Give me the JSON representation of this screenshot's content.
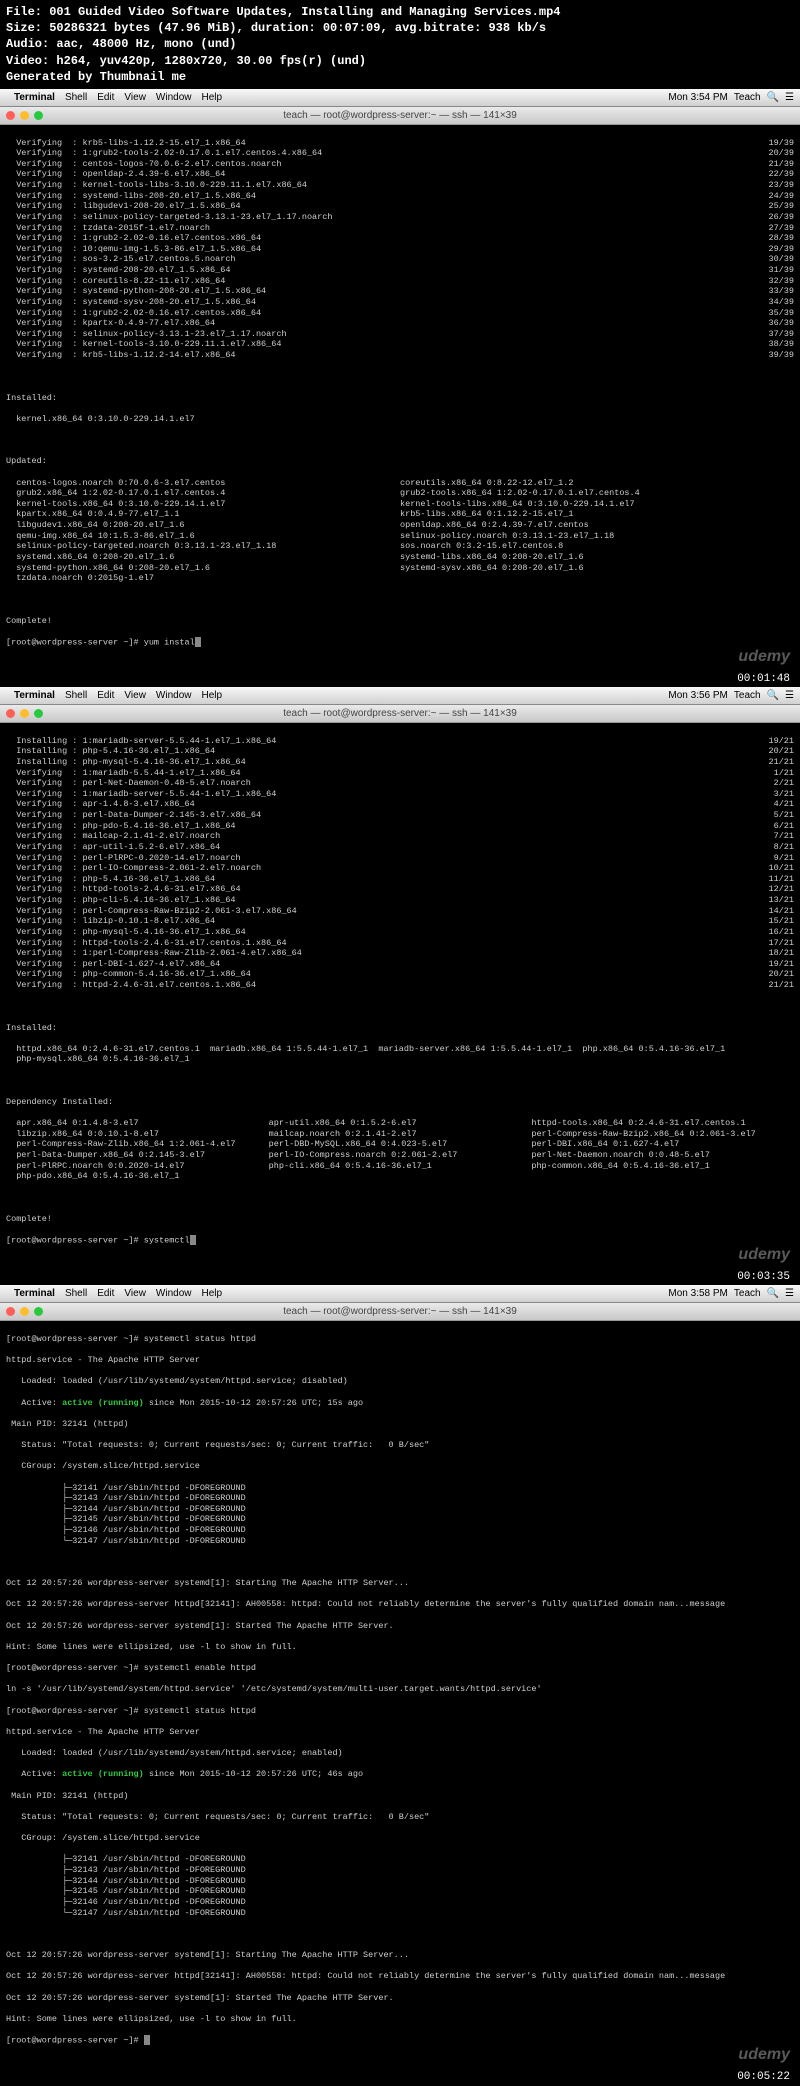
{
  "header": {
    "filename": "File: 001 Guided Video Software Updates, Installing and Managing Services.mp4",
    "size": "Size: 50286321 bytes (47.96 MiB), duration: 00:07:09, avg.bitrate: 938 kb/s",
    "audio": "Audio: aac, 48000 Hz, mono (und)",
    "video": "Video: h264, yuv420p, 1280x720, 30.00 fps(r) (und)",
    "generated": "Generated by Thumbnail me"
  },
  "menubar": {
    "items": [
      "Terminal",
      "Shell",
      "Edit",
      "View",
      "Window",
      "Help"
    ],
    "teach": "Teach",
    "time1": "Mon 3:54 PM",
    "time2": "Mon 3:56 PM",
    "time3": "Mon 3:58 PM"
  },
  "window_title": "teach — root@wordpress-server:~ — ssh — 141×39",
  "panel1": {
    "verify_rows": [
      {
        "l": "  Verifying  : krb5-libs-1.12.2-15.el7_1.x86_64",
        "r": "19/39"
      },
      {
        "l": "  Verifying  : 1:grub2-tools-2.02-0.17.0.1.el7.centos.4.x86_64",
        "r": "20/39"
      },
      {
        "l": "  Verifying  : centos-logos-70.0.6-2.el7.centos.noarch",
        "r": "21/39"
      },
      {
        "l": "  Verifying  : openldap-2.4.39-6.el7.x86_64",
        "r": "22/39"
      },
      {
        "l": "  Verifying  : kernel-tools-libs-3.10.0-229.11.1.el7.x86_64",
        "r": "23/39"
      },
      {
        "l": "  Verifying  : systemd-libs-208-20.el7_1.5.x86_64",
        "r": "24/39"
      },
      {
        "l": "  Verifying  : libgudev1-208-20.el7_1.5.x86_64",
        "r": "25/39"
      },
      {
        "l": "  Verifying  : selinux-policy-targeted-3.13.1-23.el7_1.17.noarch",
        "r": "26/39"
      },
      {
        "l": "  Verifying  : tzdata-2015f-1.el7.noarch",
        "r": "27/39"
      },
      {
        "l": "  Verifying  : 1:grub2-2.02-0.16.el7.centos.x86_64",
        "r": "28/39"
      },
      {
        "l": "  Verifying  : 10:qemu-img-1.5.3-86.el7_1.5.x86_64",
        "r": "29/39"
      },
      {
        "l": "  Verifying  : sos-3.2-15.el7.centos.5.noarch",
        "r": "30/39"
      },
      {
        "l": "  Verifying  : systemd-208-20.el7_1.5.x86_64",
        "r": "31/39"
      },
      {
        "l": "  Verifying  : coreutils-8.22-11.el7.x86_64",
        "r": "32/39"
      },
      {
        "l": "  Verifying  : systemd-python-208-20.el7_1.5.x86_64",
        "r": "33/39"
      },
      {
        "l": "  Verifying  : systemd-sysv-208-20.el7_1.5.x86_64",
        "r": "34/39"
      },
      {
        "l": "  Verifying  : 1:grub2-2.02-0.16.el7.centos.x86_64",
        "r": "35/39"
      },
      {
        "l": "  Verifying  : kpartx-0.4.9-77.el7.x86_64",
        "r": "36/39"
      },
      {
        "l": "  Verifying  : selinux-policy-3.13.1-23.el7_1.17.noarch",
        "r": "37/39"
      },
      {
        "l": "  Verifying  : kernel-tools-3.10.0-229.11.1.el7.x86_64",
        "r": "38/39"
      },
      {
        "l": "  Verifying  : krb5-libs-1.12.2-14.el7.x86_64",
        "r": "39/39"
      }
    ],
    "installed_hdr": "Installed:",
    "installed": "  kernel.x86_64 0:3.10.0-229.14.1.el7",
    "updated_hdr": "Updated:",
    "updated_col1": "  centos-logos.noarch 0:70.0.6-3.el7.centos\n  grub2.x86_64 1:2.02-0.17.0.1.el7.centos.4\n  kernel-tools.x86_64 0:3.10.0-229.14.1.el7\n  kpartx.x86_64 0:0.4.9-77.el7_1.1\n  libgudev1.x86_64 0:208-20.el7_1.6\n  qemu-img.x86_64 10:1.5.3-86.el7_1.6\n  selinux-policy-targeted.noarch 0:3.13.1-23.el7_1.18\n  systemd.x86_64 0:208-20.el7_1.6\n  systemd-python.x86_64 0:208-20.el7_1.6\n  tzdata.noarch 0:2015g-1.el7",
    "updated_col2": "coreutils.x86_64 0:8.22-12.el7_1.2\ngrub2-tools.x86_64 1:2.02-0.17.0.1.el7.centos.4\nkernel-tools-libs.x86_64 0:3.10.0-229.14.1.el7\nkrb5-libs.x86_64 0:1.12.2-15.el7_1\nopenldap.x86_64 0:2.4.39-7.el7.centos\nselinux-policy.noarch 0:3.13.1-23.el7_1.18\nsos.noarch 0:3.2-15.el7.centos.8\nsystemd-libs.x86_64 0:208-20.el7_1.6\nsystemd-sysv.x86_64 0:208-20.el7_1.6",
    "complete": "Complete!",
    "prompt": "[root@wordpress-server ~]# yum instal",
    "timestamp": "00:01:48"
  },
  "panel2": {
    "rows": [
      {
        "l": "  Installing : 1:mariadb-server-5.5.44-1.el7_1.x86_64",
        "r": "19/21"
      },
      {
        "l": "  Installing : php-5.4.16-36.el7_1.x86_64",
        "r": "20/21"
      },
      {
        "l": "  Installing : php-mysql-5.4.16-36.el7_1.x86_64",
        "r": "21/21"
      },
      {
        "l": "  Verifying  : 1:mariadb-5.5.44-1.el7_1.x86_64",
        "r": "1/21"
      },
      {
        "l": "  Verifying  : perl-Net-Daemon-0.48-5.el7.noarch",
        "r": "2/21"
      },
      {
        "l": "  Verifying  : 1:mariadb-server-5.5.44-1.el7_1.x86_64",
        "r": "3/21"
      },
      {
        "l": "  Verifying  : apr-1.4.8-3.el7.x86_64",
        "r": "4/21"
      },
      {
        "l": "  Verifying  : perl-Data-Dumper-2.145-3.el7.x86_64",
        "r": "5/21"
      },
      {
        "l": "  Verifying  : php-pdo-5.4.16-36.el7_1.x86_64",
        "r": "6/21"
      },
      {
        "l": "  Verifying  : mailcap-2.1.41-2.el7.noarch",
        "r": "7/21"
      },
      {
        "l": "  Verifying  : apr-util-1.5.2-6.el7.x86_64",
        "r": "8/21"
      },
      {
        "l": "  Verifying  : perl-PlRPC-0.2020-14.el7.noarch",
        "r": "9/21"
      },
      {
        "l": "  Verifying  : perl-IO-Compress-2.061-2.el7.noarch",
        "r": "10/21"
      },
      {
        "l": "  Verifying  : php-5.4.16-36.el7_1.x86_64",
        "r": "11/21"
      },
      {
        "l": "  Verifying  : httpd-tools-2.4.6-31.el7.x86_64",
        "r": "12/21"
      },
      {
        "l": "  Verifying  : php-cli-5.4.16-36.el7_1.x86_64",
        "r": "13/21"
      },
      {
        "l": "  Verifying  : perl-Compress-Raw-Bzip2-2.061-3.el7.x86_64",
        "r": "14/21"
      },
      {
        "l": "  Verifying  : libzip-0.10.1-8.el7.x86_64",
        "r": "15/21"
      },
      {
        "l": "  Verifying  : php-mysql-5.4.16-36.el7_1.x86_64",
        "r": "16/21"
      },
      {
        "l": "  Verifying  : httpd-tools-2.4.6-31.el7.centos.1.x86_64",
        "r": "17/21"
      },
      {
        "l": "  Verifying  : 1:perl-Compress-Raw-Zlib-2.061-4.el7.x86_64",
        "r": "18/21"
      },
      {
        "l": "  Verifying  : perl-DBI-1.627-4.el7.x86_64",
        "r": "19/21"
      },
      {
        "l": "  Verifying  : php-common-5.4.16-36.el7_1.x86_64",
        "r": "20/21"
      },
      {
        "l": "  Verifying  : httpd-2.4.6-31.el7.centos.1.x86_64",
        "r": "21/21"
      }
    ],
    "installed_hdr": "Installed:",
    "installed": "  httpd.x86_64 0:2.4.6-31.el7.centos.1  mariadb.x86_64 1:5.5.44-1.el7_1  mariadb-server.x86_64 1:5.5.44-1.el7_1  php.x86_64 0:5.4.16-36.el7_1\n  php-mysql.x86_64 0:5.4.16-36.el7_1",
    "dep_hdr": "Dependency Installed:",
    "dep_col1": "  apr.x86_64 0:1.4.8-3.el7\n  libzip.x86_64 0:0.10.1-8.el7\n  perl-Compress-Raw-Zlib.x86_64 1:2.061-4.el7\n  perl-Data-Dumper.x86_64 0:2.145-3.el7\n  perl-PlRPC.noarch 0:0.2020-14.el7\n  php-pdo.x86_64 0:5.4.16-36.el7_1",
    "dep_col2": "apr-util.x86_64 0:1.5.2-6.el7\nmailcap.noarch 0:2.1.41-2.el7\nperl-DBD-MySQL.x86_64 0:4.023-5.el7\nperl-IO-Compress.noarch 0:2.061-2.el7\nphp-cli.x86_64 0:5.4.16-36.el7_1",
    "dep_col3": "httpd-tools.x86_64 0:2.4.6-31.el7.centos.1\nperl-Compress-Raw-Bzip2.x86_64 0:2.061-3.el7\nperl-DBI.x86_64 0:1.627-4.el7\nperl-Net-Daemon.noarch 0:0.48-5.el7\nphp-common.x86_64 0:5.4.16-36.el7_1",
    "complete": "Complete!",
    "prompt": "[root@wordpress-server ~]# systemctl",
    "timestamp": "00:03:35"
  },
  "panel3": {
    "line1": "[root@wordpress-server ~]# systemctl status httpd",
    "line2": "httpd.service - The Apache HTTP Server",
    "line3": "   Loaded: loaded (/usr/lib/systemd/system/httpd.service; disabled)",
    "active_pre": "   Active: ",
    "active_green": "active (running)",
    "active_post": " since Mon 2015-10-12 20:57:26 UTC; 15s ago",
    "line5": " Main PID: 32141 (httpd)",
    "line6": "   Status: \"Total requests: 0; Current requests/sec: 0; Current traffic:   0 B/sec\"",
    "line7": "   CGroup: /system.slice/httpd.service",
    "tree": "           ├─32141 /usr/sbin/httpd -DFOREGROUND\n           ├─32143 /usr/sbin/httpd -DFOREGROUND\n           ├─32144 /usr/sbin/httpd -DFOREGROUND\n           ├─32145 /usr/sbin/httpd -DFOREGROUND\n           ├─32146 /usr/sbin/httpd -DFOREGROUND\n           └─32147 /usr/sbin/httpd -DFOREGROUND",
    "log1": "Oct 12 20:57:26 wordpress-server systemd[1]: Starting The Apache HTTP Server...",
    "log2": "Oct 12 20:57:26 wordpress-server httpd[32141]: AH00558: httpd: Could not reliably determine the server's fully qualified domain nam...message",
    "log3": "Oct 12 20:57:26 wordpress-server systemd[1]: Started The Apache HTTP Server.",
    "hint": "Hint: Some lines were ellipsized, use -l to show in full.",
    "cmd2": "[root@wordpress-server ~]# systemctl enable httpd",
    "ln": "ln -s '/usr/lib/systemd/system/httpd.service' '/etc/systemd/system/multi-user.target.wants/httpd.service'",
    "cmd3": "[root@wordpress-server ~]# systemctl status httpd",
    "line2b": "httpd.service - The Apache HTTP Server",
    "line3b": "   Loaded: loaded (/usr/lib/systemd/system/httpd.service; enabled)",
    "active_post_b": " since Mon 2015-10-12 20:57:26 UTC; 46s ago",
    "prompt_final": "[root@wordpress-server ~]# ",
    "timestamp": "00:05:22"
  },
  "watermark": "udemy"
}
